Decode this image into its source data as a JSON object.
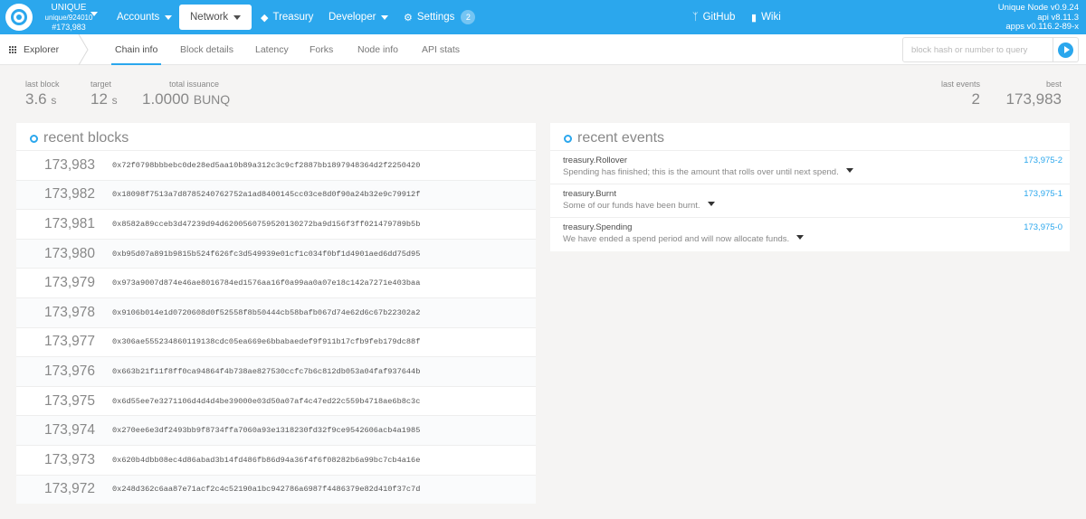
{
  "topbar": {
    "chain_name": "UNIQUE",
    "chain_spec": "unique/924010",
    "chain_block": "#173,983",
    "menu": {
      "accounts": "Accounts",
      "network": "Network",
      "treasury": "Treasury",
      "developer": "Developer",
      "settings": "Settings",
      "settings_badge": "2",
      "github": "GitHub",
      "wiki": "Wiki"
    },
    "version": {
      "node": "Unique Node v0.9.24",
      "api": "api v8.11.3",
      "apps": "apps v0.116.2-89-x"
    }
  },
  "subnav": {
    "section": "Explorer",
    "tabs": [
      "Chain info",
      "Block details",
      "Latency",
      "Forks",
      "Node info",
      "API stats"
    ],
    "active_tab": "Chain info",
    "search_placeholder": "block hash or number to query"
  },
  "summary": {
    "last_block_label": "last block",
    "last_block_value": "3.6",
    "last_block_unit": "s",
    "target_label": "target",
    "target_value": "12",
    "target_unit": "s",
    "issuance_label": "total issuance",
    "issuance_value": "1.0000",
    "issuance_unit": "BUNQ",
    "last_events_label": "last events",
    "last_events_value": "2",
    "best_label": "best",
    "best_value": "173,983"
  },
  "recent_blocks": {
    "title": "recent blocks",
    "rows": [
      {
        "number": "173,983",
        "hash": "0x72f0798bbbebc0de28ed5aa10b89a312c3c9cf2887bb1897948364d2f2250420"
      },
      {
        "number": "173,982",
        "hash": "0x18098f7513a7d8785240762752a1ad8400145cc03ce8d0f90a24b32e9c79912f"
      },
      {
        "number": "173,981",
        "hash": "0x8582a89cceb3d47239d94d6200560759520130272ba9d156f3ff021479789b5b"
      },
      {
        "number": "173,980",
        "hash": "0xb95d07a891b9815b524f626fc3d549939e01cf1c034f0bf1d4901aed6dd75d95"
      },
      {
        "number": "173,979",
        "hash": "0x973a9007d874e46ae8016784ed1576aa16f0a99aa0a07e18c142a7271e403baa"
      },
      {
        "number": "173,978",
        "hash": "0x9106b014e1d0720608d0f52558f8b50444cb58bafb067d74e62d6c67b22302a2"
      },
      {
        "number": "173,977",
        "hash": "0x306ae555234860119138cdc05ea669e6bbabaedef9f911b17cfb9feb179dc88f"
      },
      {
        "number": "173,976",
        "hash": "0x663b21f11f8ff0ca94864f4b738ae827530ccfc7b6c812db053a04faf937644b"
      },
      {
        "number": "173,975",
        "hash": "0x6d55ee7e3271106d4d4d4be39000e03d50a07af4c47ed22c559b4718ae6b8c3c"
      },
      {
        "number": "173,974",
        "hash": "0x270ee6e3df2493bb9f8734ffa7060a93e1318230fd32f9ce9542606acb4a1985"
      },
      {
        "number": "173,973",
        "hash": "0x620b4dbb08ec4d86abad3b14fd486fb86d94a36f4f6f08282b6a99bc7cb4a16e"
      },
      {
        "number": "173,972",
        "hash": "0x248d362c6aa87e71acf2c4c52190a1bc942786a6987f4486379e82d410f37c7d"
      }
    ]
  },
  "recent_events": {
    "title": "recent events",
    "rows": [
      {
        "name": "treasury.Rollover",
        "desc": "Spending has finished; this is the amount that rolls over until next spend.",
        "id": "173,975-2"
      },
      {
        "name": "treasury.Burnt",
        "desc": "Some of our funds have been burnt.",
        "id": "173,975-1"
      },
      {
        "name": "treasury.Spending",
        "desc": "We have ended a spend period and will now allocate funds.",
        "id": "173,975-0"
      }
    ]
  }
}
